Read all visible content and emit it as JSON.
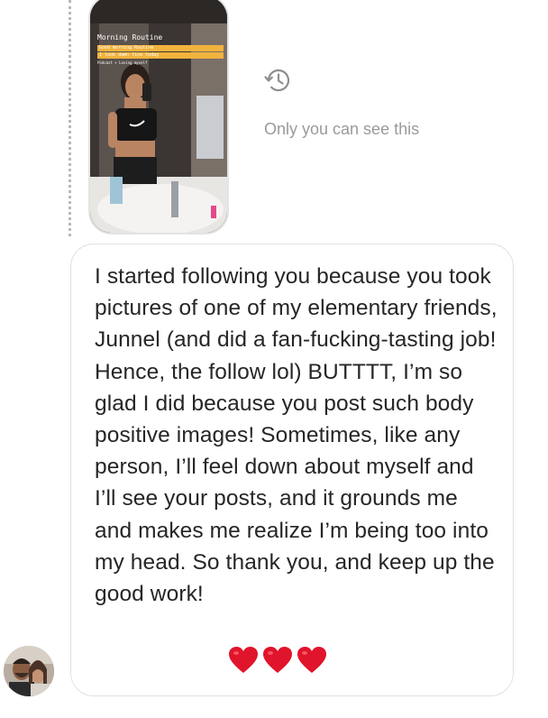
{
  "story": {
    "title": "Morning Routine",
    "highlight_line_1": "Good morning Routine",
    "highlight_line_2": "I look damn fine today",
    "footer_line": "Podcast + Loving myself"
  },
  "story_visibility": {
    "icon": "private-history-icon",
    "text": "Only you can see this"
  },
  "message": {
    "text": "I started following you because you took pictures of one of my elementary friends, Junnel (and did a fan-fucking-tasting job! Hence, the follow lol) BUTTTT, I’m so glad I did because you post such body positive images! Sometimes, like any person, I’ll feel down about myself and I’ll see your posts, and it grounds me and makes me realize I’m being too into my head. So thank you, and keep up the good work!",
    "emoji_icons": [
      "red-heart-icon",
      "red-heart-icon",
      "red-heart-icon"
    ],
    "heart_color": "#e0142b"
  },
  "sender": {
    "avatar_icon": "user-avatar"
  },
  "colors": {
    "muted_text": "#9a9a9a",
    "message_text": "#262626",
    "bubble_border": "#e0e0e0"
  }
}
